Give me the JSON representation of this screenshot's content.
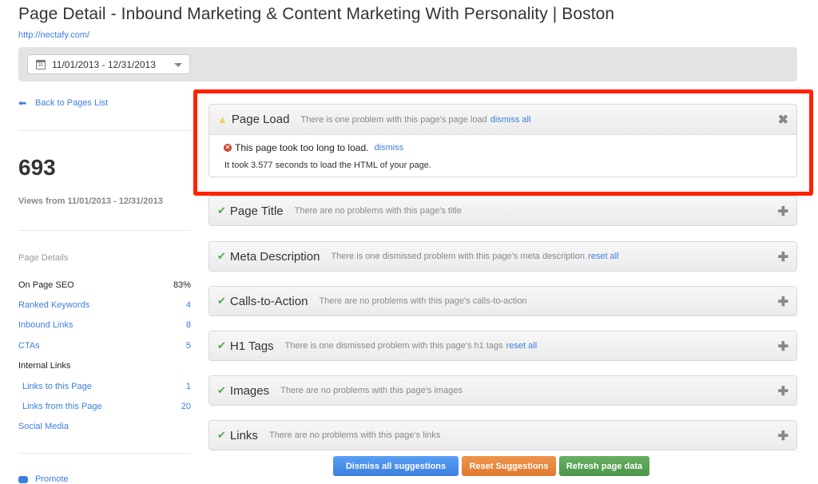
{
  "header": {
    "title": "Page Detail - Inbound Marketing & Content Marketing With Personality | Boston",
    "url": "http://nectafy.com/"
  },
  "filter": {
    "date_range": "11/01/2013 - 12/31/2013",
    "calendar_icon_text": "31"
  },
  "sidebar": {
    "back_label": "Back to Pages List",
    "views_count": "693",
    "views_label": "Views from 11/01/2013 - 12/31/2013",
    "details_heading": "Page Details",
    "details": [
      {
        "label": "On Page SEO",
        "value": "83%",
        "link": false,
        "indent": false
      },
      {
        "label": "Ranked Keywords",
        "value": "4",
        "link": true,
        "indent": false
      },
      {
        "label": "Inbound Links",
        "value": "8",
        "link": true,
        "indent": false
      },
      {
        "label": "CTAs",
        "value": "5",
        "link": true,
        "indent": false
      },
      {
        "label": "Internal Links",
        "value": "",
        "link": false,
        "indent": false
      },
      {
        "label": "Links to this Page",
        "value": "1",
        "link": true,
        "indent": true
      },
      {
        "label": "Links from this Page",
        "value": "20",
        "link": true,
        "indent": true
      },
      {
        "label": "Social Media",
        "value": "",
        "link": true,
        "indent": false
      }
    ],
    "promote_label": "Promote"
  },
  "panels": [
    {
      "title": "Page Load",
      "status": "warning",
      "message": "There is one problem with this page's page load",
      "link": "dismiss all",
      "expanded": true,
      "action_icon": "close",
      "problem": {
        "text": "This page took too long to load.",
        "dismiss_label": "dismiss",
        "detail": "It took 3.577 seconds to load the HTML of your page."
      }
    },
    {
      "title": "Page Title",
      "status": "ok",
      "message": "There are no problems with this page's title",
      "link": "",
      "expanded": false,
      "action_icon": "plus"
    },
    {
      "title": "Meta Description",
      "status": "ok",
      "message": "There is one dismissed problem with this page's meta description",
      "link": "reset all",
      "expanded": false,
      "action_icon": "plus"
    },
    {
      "title": "Calls-to-Action",
      "status": "ok",
      "message": "There are no problems with this page's calls-to-action",
      "link": "",
      "expanded": false,
      "action_icon": "plus"
    },
    {
      "title": "H1 Tags",
      "status": "ok",
      "message": "There is one dismissed problem with this page's h1 tags",
      "link": "reset all",
      "expanded": false,
      "action_icon": "plus"
    },
    {
      "title": "Images",
      "status": "ok",
      "message": "There are no problems with this page's images",
      "link": "",
      "expanded": false,
      "action_icon": "plus"
    },
    {
      "title": "Links",
      "status": "ok",
      "message": "There are no problems with this page's links",
      "link": "",
      "expanded": false,
      "action_icon": "plus"
    }
  ],
  "actions": {
    "dismiss_all": "Dismiss all suggestions",
    "reset": "Reset Suggestions",
    "refresh": "Refresh page data"
  },
  "icons": {
    "check": "✔",
    "warning": "▲",
    "close": "✖",
    "plus": "✚",
    "error": "✕",
    "back": "➥"
  },
  "colors": {
    "link": "#3d7ee0",
    "ok": "#4ca84c",
    "warning": "#f0d060",
    "error": "#d23a2a",
    "highlight": "#ff2200",
    "btn_blue": "#3a7ee0",
    "btn_orange": "#e07a30",
    "btn_green": "#4b9548"
  }
}
